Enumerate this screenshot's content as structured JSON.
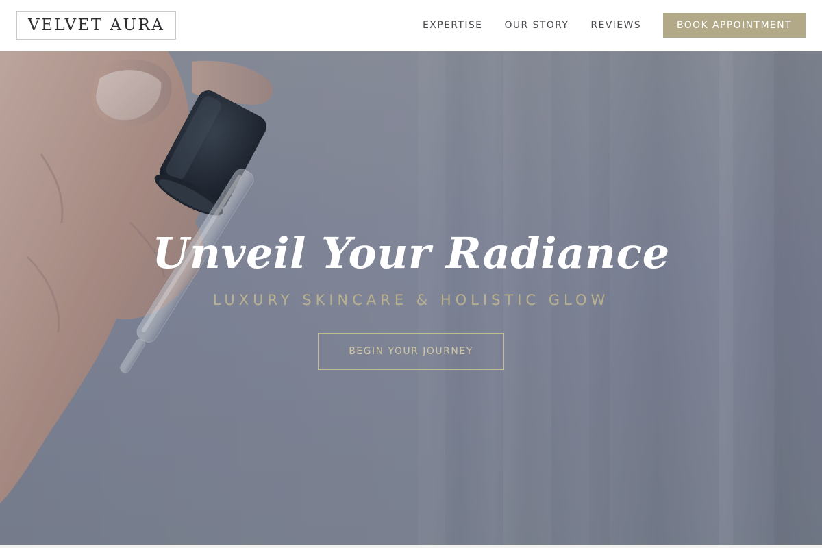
{
  "header": {
    "logo": "VELVET AURA",
    "nav": [
      {
        "label": "EXPERTISE"
      },
      {
        "label": "OUR STORY"
      },
      {
        "label": "REVIEWS"
      }
    ],
    "book_button": "BOOK APPOINTMENT"
  },
  "hero": {
    "title": "Unveil Your Radiance",
    "subtitle": "LUXURY SKINCARE & HOLISTIC GLOW",
    "cta": "BEGIN YOUR JOURNEY",
    "image": "hand-holding-serum-dropper"
  },
  "colors": {
    "accent": "#b1a988",
    "header_bg": "#ffffff",
    "hero_bg": "#80869a",
    "title_text": "#ffffff",
    "subtitle_text": "#b9b18e"
  }
}
